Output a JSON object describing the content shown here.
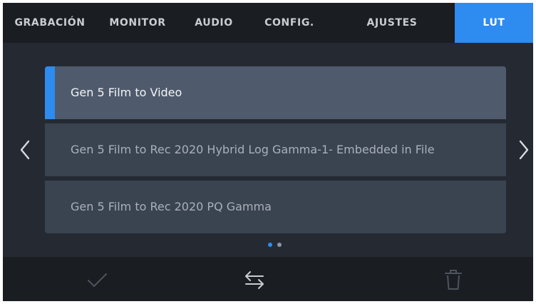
{
  "tabs": [
    {
      "label": "GRABACIÓN",
      "active": false
    },
    {
      "label": "MONITOR",
      "active": false
    },
    {
      "label": "AUDIO",
      "active": false
    },
    {
      "label": "CONFIG.",
      "active": false
    },
    {
      "label": "AJUSTES",
      "active": false
    },
    {
      "label": "LUT",
      "active": true
    }
  ],
  "lut_list": {
    "items": [
      {
        "label": "Gen 5 Film to Video",
        "selected": true
      },
      {
        "label": "Gen 5 Film to Rec 2020 Hybrid Log Gamma-1- Embedded in File",
        "selected": false
      },
      {
        "label": "Gen 5 Film to Rec 2020 PQ Gamma",
        "selected": false
      }
    ]
  },
  "pagination": {
    "current_page": 1,
    "total_pages": 2
  },
  "icons": {
    "prev": "chevron-left-icon",
    "next": "chevron-right-icon",
    "apply": "checkmark-icon",
    "swap": "swap-arrows-icon",
    "delete": "trash-icon"
  },
  "colors": {
    "accent": "#2e8bf0",
    "background": "#252a32",
    "bar": "#1a1d22",
    "row": "#3a4350",
    "row_selected": "#4f5b6c"
  }
}
